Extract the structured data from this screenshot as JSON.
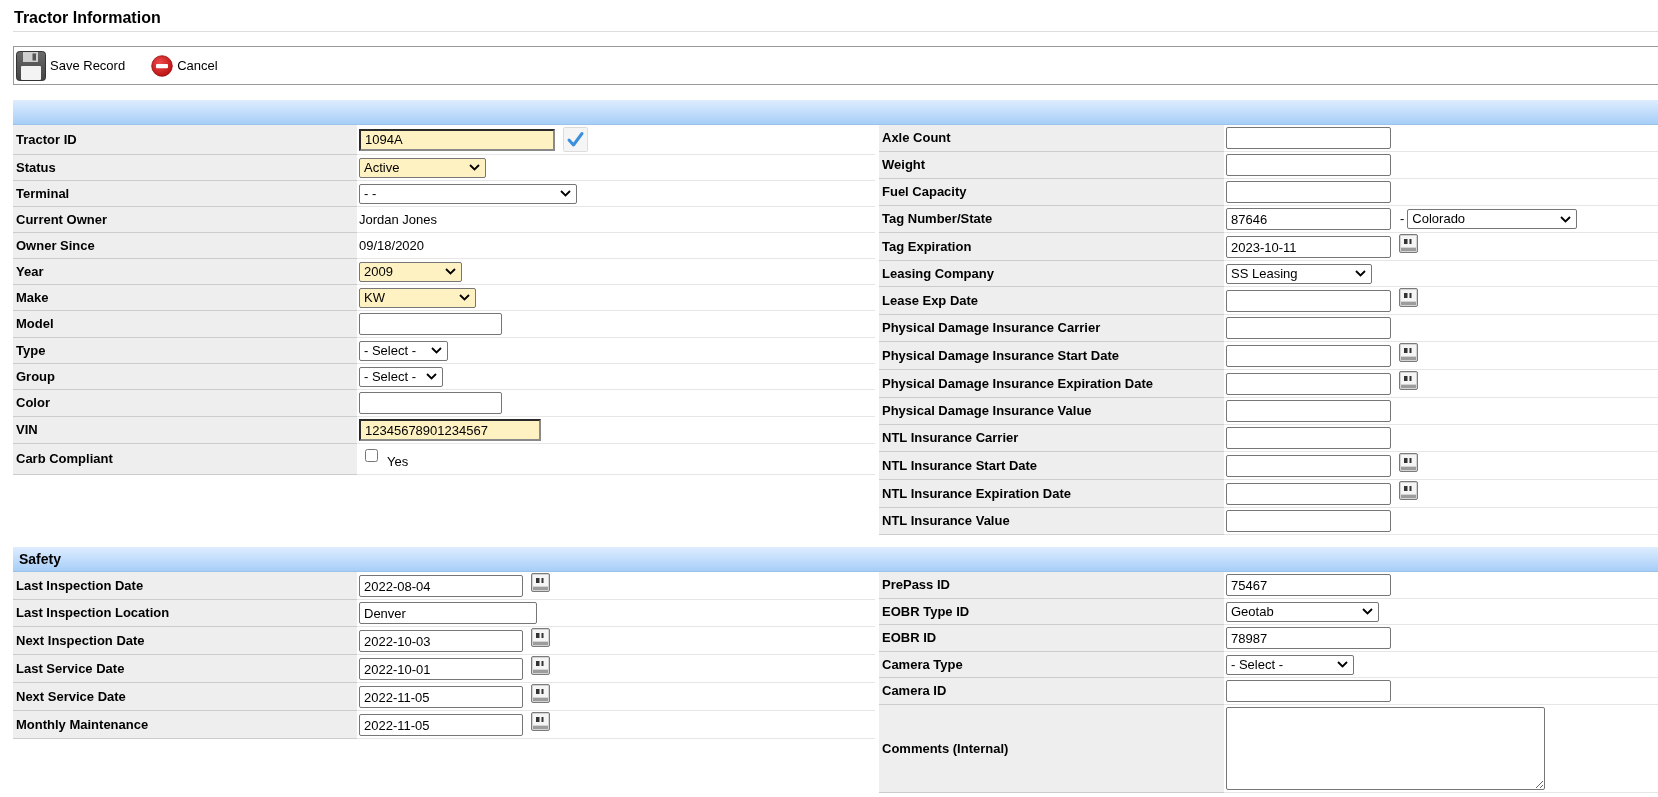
{
  "page": {
    "title": "Tractor Information"
  },
  "toolbar": [
    {
      "kind": "save",
      "label": "Save Record"
    },
    {
      "kind": "cancel",
      "label": "Cancel"
    }
  ],
  "sections": [
    {
      "left": [
        {
          "label": "Tractor ID",
          "kind": "text",
          "value": "1094A",
          "highlighted": true,
          "verified": true
        },
        {
          "label": "Status",
          "kind": "select",
          "value": "Active",
          "highlighted": true
        },
        {
          "label": "Terminal",
          "kind": "select",
          "value": "- -",
          "highlighted": false
        },
        {
          "label": "Current Owner",
          "kind": "static",
          "value": "Jordan Jones"
        },
        {
          "label": "Owner Since",
          "kind": "static",
          "value": "09/18/2020"
        },
        {
          "label": "Year",
          "kind": "select",
          "value": "2009",
          "highlighted": true
        },
        {
          "label": "Make",
          "kind": "select",
          "value": "KW",
          "highlighted": true
        },
        {
          "label": "Model",
          "kind": "text",
          "highlighted": false
        },
        {
          "label": "Type",
          "kind": "select",
          "value": "- Select -",
          "highlighted": false
        },
        {
          "label": "Group",
          "kind": "select",
          "value": "- Select -",
          "highlighted": false
        },
        {
          "label": "Color",
          "kind": "text",
          "highlighted": false
        },
        {
          "label": "VIN",
          "kind": "text",
          "value": "12345678901234567",
          "highlighted": true
        },
        {
          "label": "Carb Compliant",
          "kind": "checkbox",
          "checked": false,
          "option": "Yes"
        }
      ],
      "right": [
        {
          "label": "Axle Count",
          "kind": "text",
          "highlighted": false
        },
        {
          "label": "Weight",
          "kind": "text",
          "highlighted": false
        },
        {
          "label": "Fuel Capacity",
          "kind": "text",
          "highlighted": false
        },
        {
          "label": "Tag Number/State",
          "kind": "text_select",
          "value": "87646",
          "separator": "-",
          "select_value": "Colorado",
          "highlighted": false
        },
        {
          "label": "Tag Expiration",
          "kind": "date",
          "value": "2023-10-11",
          "highlighted": false
        },
        {
          "label": "Leasing Company",
          "kind": "select",
          "value": "SS Leasing",
          "highlighted": false
        },
        {
          "label": "Lease Exp Date",
          "kind": "date",
          "highlighted": false
        },
        {
          "label": "Physical Damage Insurance Carrier",
          "kind": "text",
          "highlighted": false
        },
        {
          "label": "Physical Damage Insurance Start Date",
          "kind": "date",
          "highlighted": false
        },
        {
          "label": "Physical Damage Insurance Expiration Date",
          "kind": "date",
          "highlighted": false
        },
        {
          "label": "Physical Damage Insurance Value",
          "kind": "text",
          "highlighted": false
        },
        {
          "label": "NTL Insurance Carrier",
          "kind": "text",
          "highlighted": false
        },
        {
          "label": "NTL Insurance Start Date",
          "kind": "date",
          "highlighted": false
        },
        {
          "label": "NTL Insurance Expiration Date",
          "kind": "date",
          "highlighted": false
        },
        {
          "label": "NTL Insurance Value",
          "kind": "text",
          "highlighted": false
        }
      ]
    },
    {
      "title": "Safety",
      "left": [
        {
          "label": "Last Inspection Date",
          "kind": "date",
          "value": "2022-08-04",
          "highlighted": false
        },
        {
          "label": "Last Inspection Location",
          "kind": "text",
          "value": "Denver",
          "highlighted": false
        },
        {
          "label": "Next Inspection Date",
          "kind": "date",
          "value": "2022-10-03",
          "highlighted": false
        },
        {
          "label": "Last Service Date",
          "kind": "date",
          "value": "2022-10-01",
          "highlighted": false
        },
        {
          "label": "Next Service Date",
          "kind": "date",
          "value": "2022-11-05",
          "highlighted": false
        },
        {
          "label": "Monthly Maintenance",
          "kind": "date",
          "value": "2022-11-05",
          "highlighted": false
        }
      ],
      "right": [
        {
          "label": "PrePass ID",
          "kind": "text",
          "value": "75467",
          "highlighted": false
        },
        {
          "label": "EOBR Type ID",
          "kind": "select",
          "value": "Geotab",
          "highlighted": false
        },
        {
          "label": "EOBR ID",
          "kind": "text",
          "value": "78987",
          "highlighted": false
        },
        {
          "label": "Camera Type",
          "kind": "select",
          "value": "- Select -",
          "highlighted": false
        },
        {
          "label": "Camera ID",
          "kind": "text",
          "highlighted": false
        },
        {
          "label": "Comments (Internal)",
          "kind": "textarea",
          "highlighted": false
        }
      ]
    }
  ]
}
